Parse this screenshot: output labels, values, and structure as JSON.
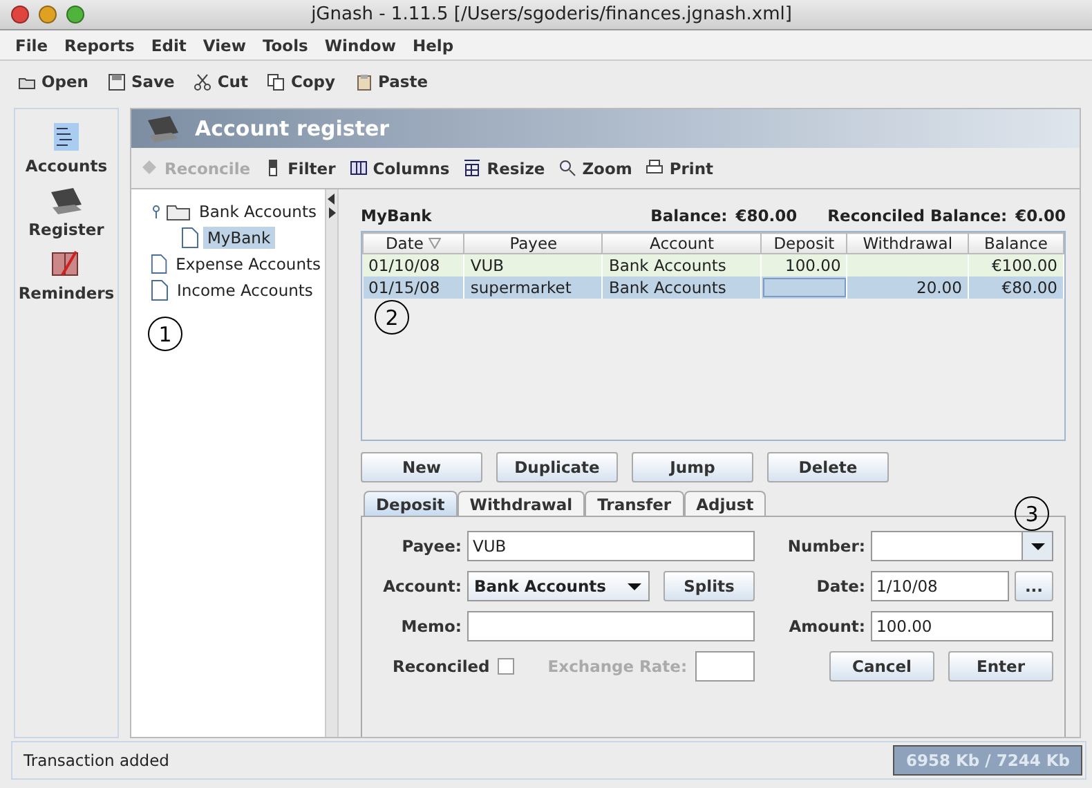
{
  "window": {
    "title": "jGnash - 1.11.5  [/Users/sgoderis/finances.jgnash.xml]"
  },
  "menu": [
    "File",
    "Reports",
    "Edit",
    "View",
    "Tools",
    "Window",
    "Help"
  ],
  "toolbar": [
    {
      "label": "Open",
      "kind": "open"
    },
    {
      "label": "Save",
      "kind": "save"
    },
    {
      "label": "Cut",
      "kind": "cut"
    },
    {
      "label": "Copy",
      "kind": "copy"
    },
    {
      "label": "Paste",
      "kind": "paste"
    }
  ],
  "sidebar": {
    "items": [
      {
        "label": "Accounts",
        "kind": "accounts"
      },
      {
        "label": "Register",
        "kind": "register"
      },
      {
        "label": "Reminders",
        "kind": "reminders"
      }
    ]
  },
  "panel": {
    "title": "Account register",
    "toolbar": [
      {
        "label": "Reconcile",
        "kind": "reconcile",
        "disabled": true
      },
      {
        "label": "Filter",
        "kind": "filter",
        "disabled": false
      },
      {
        "label": "Columns",
        "kind": "columns",
        "disabled": false
      },
      {
        "label": "Resize",
        "kind": "resize",
        "disabled": false
      },
      {
        "label": "Zoom",
        "kind": "zoom",
        "disabled": false
      },
      {
        "label": "Print",
        "kind": "print",
        "disabled": false
      }
    ],
    "tree": [
      {
        "label": "Bank Accounts",
        "kind": "folder",
        "expanded": true,
        "selected": false,
        "children": [
          {
            "label": "MyBank",
            "kind": "file",
            "selected": true
          }
        ]
      },
      {
        "label": "Expense Accounts",
        "kind": "file",
        "selected": false
      },
      {
        "label": "Income Accounts",
        "kind": "file",
        "selected": false
      }
    ],
    "account": "MyBank",
    "balance_label": "Balance:",
    "balance": "€80.00",
    "reconciled_label": "Reconciled Balance:",
    "reconciled": "€0.00",
    "table": {
      "columns": [
        "Date",
        "Payee",
        "Account",
        "Deposit",
        "Withdrawal",
        "Balance"
      ],
      "rows": [
        {
          "cells": [
            "01/10/08",
            "VUB",
            "Bank Accounts",
            "100.00",
            "",
            "€100.00"
          ],
          "selected": false
        },
        {
          "cells": [
            "01/15/08",
            "supermarket",
            "Bank Accounts",
            "",
            "20.00",
            "€80.00"
          ],
          "selected": true
        }
      ]
    },
    "buttons": [
      "New",
      "Duplicate",
      "Jump",
      "Delete"
    ],
    "tabs": [
      {
        "label": "Deposit",
        "selected": true
      },
      {
        "label": "Withdrawal",
        "selected": false
      },
      {
        "label": "Transfer",
        "selected": false
      },
      {
        "label": "Adjust",
        "selected": false
      }
    ],
    "form": {
      "payee_label": "Payee:",
      "payee": "VUB",
      "number_label": "Number:",
      "account_label": "Account:",
      "account": "Bank Accounts",
      "splits": "Splits",
      "date_label": "Date:",
      "date": "1/10/08",
      "date_button": "...",
      "memo_label": "Memo:",
      "amount_label": "Amount:",
      "amount": "100.00",
      "reconciled_label": "Reconciled",
      "reconciled": false,
      "exchange_label": "Exchange Rate:",
      "exchange_disabled": true,
      "cancel": "Cancel",
      "enter": "Enter"
    }
  },
  "callouts": [
    "1",
    "2",
    "3"
  ],
  "status_bar": {
    "message": "Transaction added",
    "memory": "6958 Kb / 7244 Kb"
  }
}
